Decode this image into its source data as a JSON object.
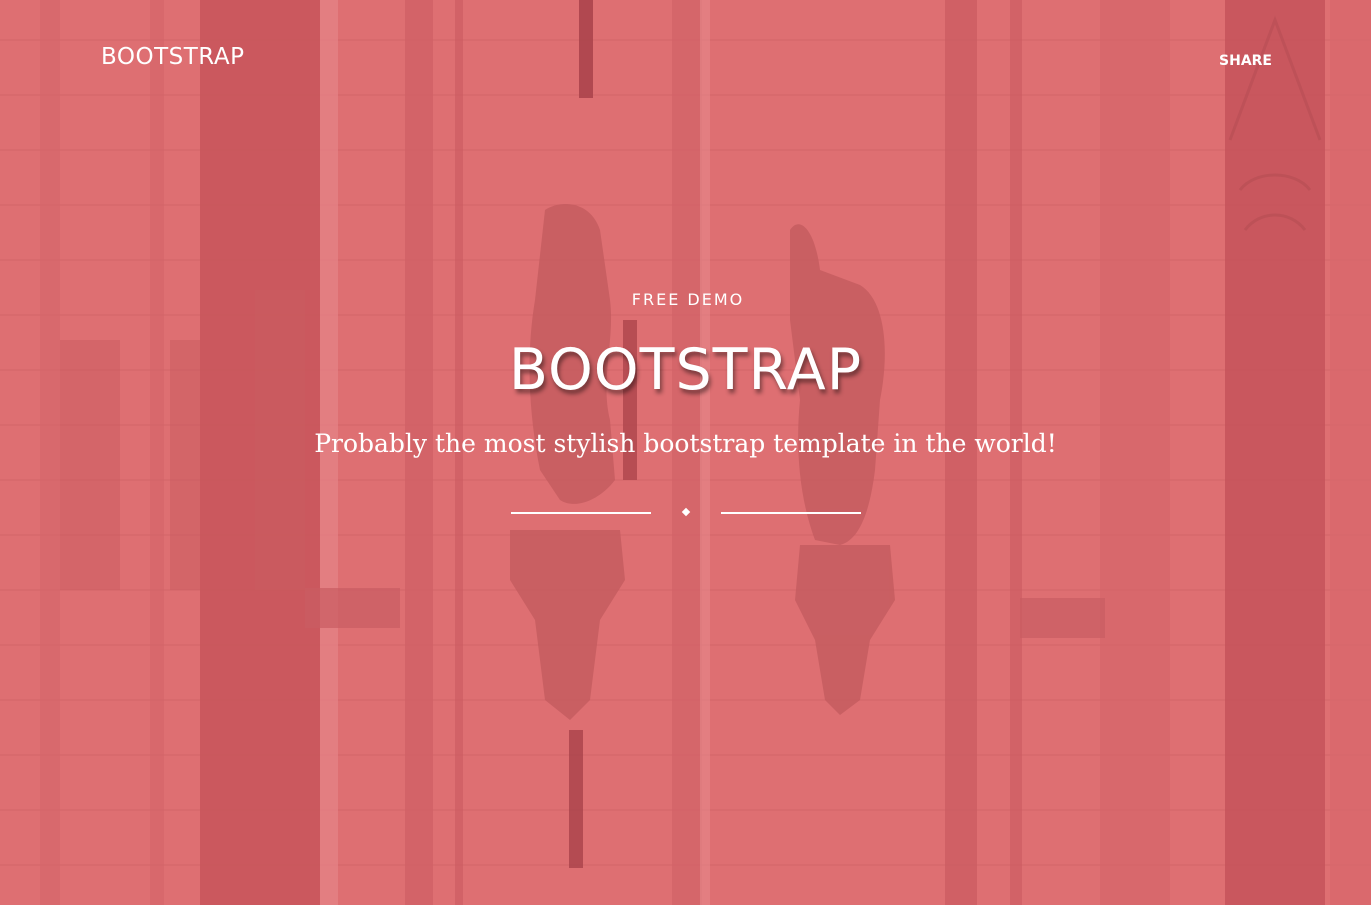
{
  "navbar": {
    "brand": "BOOTSTRAP",
    "share_label": "SHARE"
  },
  "hero": {
    "eyebrow": "FREE DEMO",
    "title": "BOOTSTRAP",
    "subtitle": "Probably the most stylish bootstrap template in the world!",
    "overlay_color": "#dd6b6f",
    "divider_icon": "diamond-icon"
  }
}
